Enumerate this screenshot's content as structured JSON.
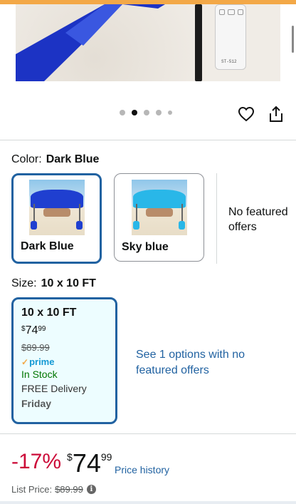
{
  "hero": {
    "remote_label": "ST-512"
  },
  "gallery": {
    "dots": 5,
    "active_index": 1
  },
  "actions": {
    "favorite_icon": "heart-icon",
    "share_icon": "share-icon"
  },
  "color": {
    "label": "Color:",
    "selected": "Dark Blue",
    "options": [
      {
        "name": "Dark Blue",
        "canopy_color": "#1f3fd0",
        "selected": true
      },
      {
        "name": "Sky blue",
        "canopy_color": "#29b7e8",
        "selected": false
      }
    ],
    "no_featured": "No featured offers"
  },
  "size": {
    "label": "Size:",
    "selected": "10 x 10 FT",
    "card": {
      "name": "10 x 10 FT",
      "price_symbol": "$",
      "price_whole": "74",
      "price_fraction": "99",
      "list_price": "$89.99",
      "prime_check": "✓",
      "prime": "prime",
      "stock": "In Stock",
      "delivery": "FREE Delivery",
      "delivery_day": "Friday"
    },
    "see_options": "See 1 options with no featured offers"
  },
  "pricing": {
    "discount": "-17%",
    "symbol": "$",
    "whole": "74",
    "fraction": "99",
    "price_history": "Price history",
    "list_label": "List Price:",
    "list_value": "$89.99",
    "info_icon": "i"
  },
  "colors": {
    "link": "#2162a1",
    "discount": "#cc0c39",
    "stock": "#007600",
    "selected_border": "#2162a1"
  }
}
